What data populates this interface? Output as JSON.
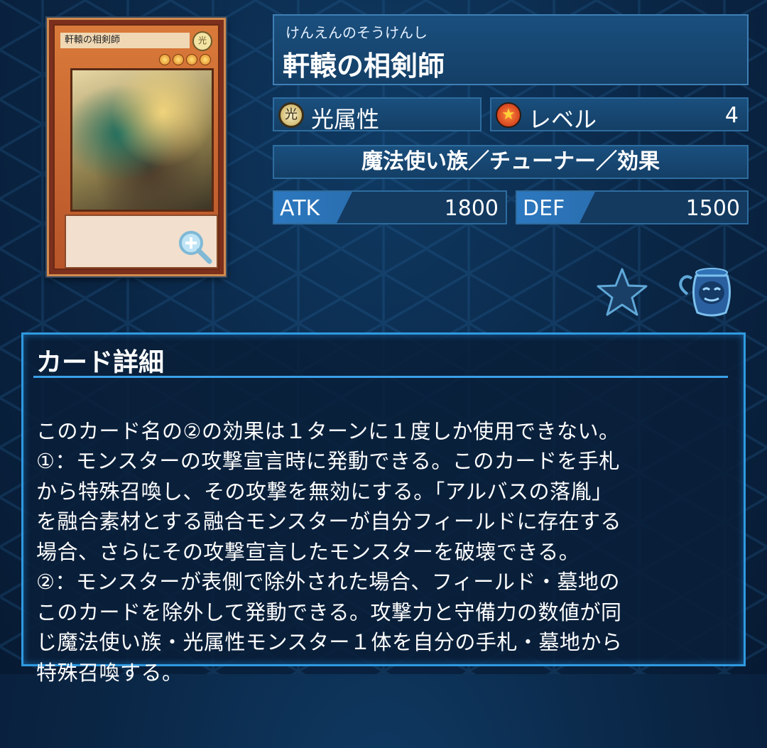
{
  "card": {
    "thumb_name": "軒轅の相剣師",
    "thumb_attr_glyph": "光",
    "stars": 4
  },
  "header": {
    "ruby": "けんえんのそうけんし",
    "name": "軒轅の相剣師"
  },
  "attribute": {
    "icon_glyph": "光",
    "label": "光属性"
  },
  "level": {
    "label": "レベル",
    "value": "4"
  },
  "type_line": "魔法使い族／チューナー／効果",
  "stats": {
    "atk_label": "ATK",
    "atk_value": "1800",
    "def_label": "DEF",
    "def_value": "1500"
  },
  "icons": [
    "zoom-icon",
    "favorite-star-icon",
    "jar-icon"
  ],
  "detail": {
    "title": "カード詳細",
    "lines": [
      "このカード名の②の効果は１ターンに１度しか使用できない。",
      "①：モンスターの攻撃宣言時に発動できる。このカードを手札",
      "から特殊召喚し、その攻撃を無効にする。「アルバスの落胤」",
      "を融合素材とする融合モンスターが自分フィールドに存在する",
      "場合、さらにその攻撃宣言したモンスターを破壊できる。",
      "②：モンスターが表側で除外された場合、フィールド・墓地の",
      "このカードを除外して発動できる。攻撃力と守備力の数値が同",
      "じ魔法使い族・光属性モンスター１体を自分の手札・墓地から",
      "特殊召喚する。"
    ]
  },
  "colors": {
    "accent": "#2f9ae0",
    "panel": "#143f66",
    "stat_tag": "#2c78c0"
  }
}
